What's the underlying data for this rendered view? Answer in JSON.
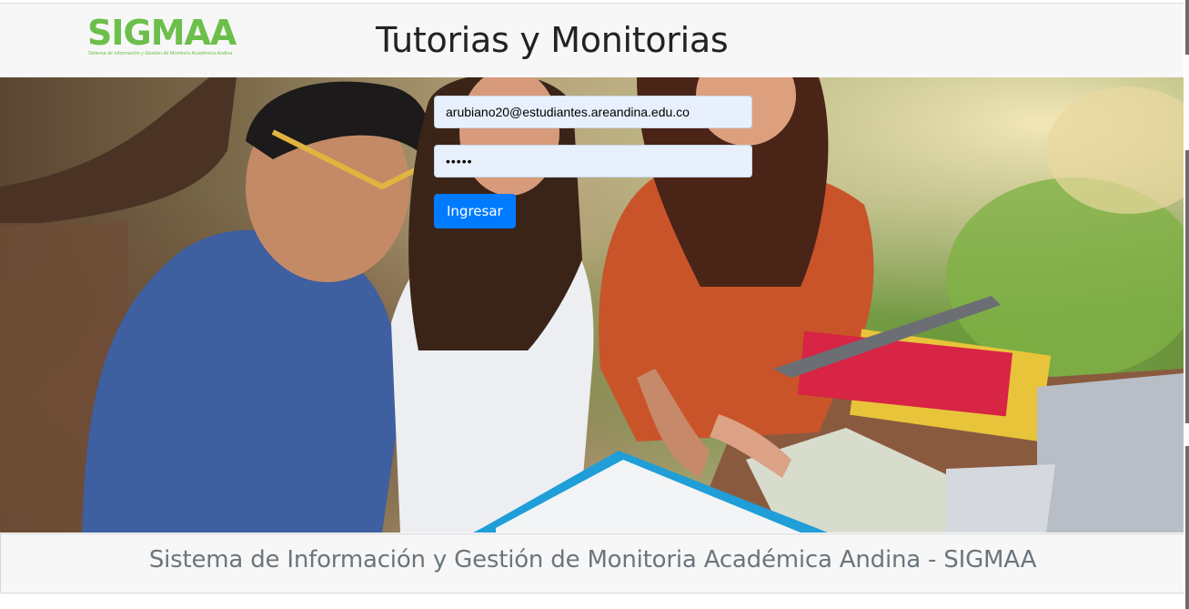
{
  "header": {
    "logo_text": "SIGMAA",
    "logo_subtitle": "Sistema de Información y Gestión de Monitoría Académica Andina",
    "title": "Tutorias y Monitorias"
  },
  "login": {
    "username_value": "arubiano20@estudiantes.areandina.edu.co",
    "password_value": "•••••",
    "submit_label": "Ingresar"
  },
  "footer": {
    "text": "Sistema de Información y Gestión de Monitoria Académica Andina - SIGMAA"
  },
  "colors": {
    "logo_green": "#6cbf4a",
    "button_blue": "#007bff",
    "input_autofill": "#e8f0fe",
    "footer_text": "#6b757d"
  }
}
